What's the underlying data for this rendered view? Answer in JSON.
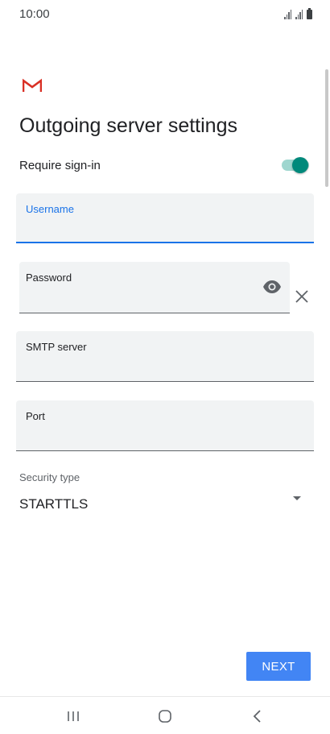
{
  "status_bar": {
    "time": "10:00"
  },
  "header": {
    "logo": "gmail-icon",
    "title": "Outgoing server settings"
  },
  "require_signin": {
    "label": "Require sign-in",
    "enabled": true,
    "color": "#00897b"
  },
  "fields": {
    "username": {
      "label": "Username",
      "value": ""
    },
    "password": {
      "label": "Password",
      "value": ""
    },
    "smtp_server": {
      "label": "SMTP server",
      "value": ""
    },
    "port": {
      "label": "Port",
      "value": ""
    }
  },
  "security": {
    "label": "Security type",
    "value": "STARTTLS"
  },
  "actions": {
    "next_label": "NEXT",
    "next_color": "#4285f4"
  },
  "nav": {
    "recents": "recents-icon",
    "home": "home-icon",
    "back": "back-icon"
  },
  "colors": {
    "accent": "#1a73e8",
    "field_bg": "#f1f3f4"
  }
}
